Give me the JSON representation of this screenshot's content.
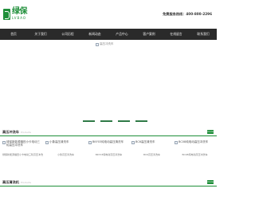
{
  "header": {
    "logo_cn": "绿保",
    "logo_en": "LVBAO",
    "hotline": "免费服务热线：400-800-2296"
  },
  "nav": {
    "items": [
      "首页",
      "关于我们",
      "公司历程",
      "新闻动态",
      "产品中心",
      "客户案例",
      "在线留言",
      "联系我们"
    ]
  },
  "banner": {
    "alt": "高压冲洗车",
    "slides": 4
  },
  "sections": [
    {
      "title": "高压冲洗车",
      "subtitle": "Products",
      "more": "more",
      "products": [
        {
          "alt": "绿保新能源福田小卡电动三轮高压冲洗车",
          "caption": "绿保新能源福田小卡电动三轮高压冲洗车"
        },
        {
          "alt": "小象高压清洗车",
          "caption": "小象高压清洗车"
        },
        {
          "alt": "BKY03纯电动高压清洗车",
          "caption": "BKY03纯电动高压清洗车"
        },
        {
          "alt": "BC6高压清洗车",
          "caption": "BC6高压清洗车"
        },
        {
          "alt": "BC08纯电动高压冲洗车",
          "caption": "BC08纯电动高压冲洗车"
        }
      ]
    },
    {
      "title": "高压清洗机",
      "subtitle": "Products",
      "more": "more"
    }
  ]
}
